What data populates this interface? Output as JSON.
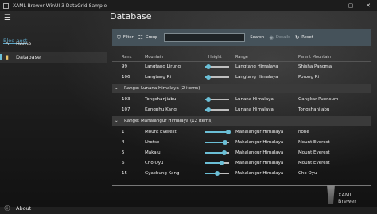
{
  "window": {
    "title": "XAML Brewer WinUI 3 DataGrid Sample",
    "minimize": "—",
    "maximize": "▢",
    "close": "✕"
  },
  "nav": {
    "menu_icon": "hamburger-icon",
    "blog_link": "Blog post",
    "items": [
      {
        "label": "Home",
        "icon": "home-icon"
      },
      {
        "label": "Database",
        "icon": "database-icon",
        "selected": true
      },
      {
        "label": "About",
        "icon": "info-icon"
      }
    ]
  },
  "page": {
    "title": "Database"
  },
  "toolbar": {
    "filter": "Filter",
    "group": "Group",
    "search_value": "",
    "search": "Search",
    "details": "Details",
    "reset": "Reset"
  },
  "grid": {
    "columns": [
      "Rank",
      "Mountain",
      "Height",
      "Range",
      "Parent Mountain"
    ],
    "accent": "#6bbfd6",
    "rows_top": [
      {
        "rank": "99",
        "mountain": "Langtang Lirung",
        "height_level": 0.12,
        "range": "Langtang Himalaya",
        "parent": "Shisha Pangma"
      },
      {
        "rank": "106",
        "mountain": "Langtang Ri",
        "height_level": 0.12,
        "range": "Langtang Himalaya",
        "parent": "Porong Ri"
      }
    ],
    "group1": {
      "label": "Range: Lunana Himalaya (2 items)"
    },
    "rows_g1": [
      {
        "rank": "103",
        "mountain": "Tongshanjiabu",
        "height_level": 0.12,
        "range": "Lunana Himalaya",
        "parent": "Gangkar Puensum"
      },
      {
        "rank": "107",
        "mountain": "Kangphu Kang",
        "height_level": 0.12,
        "range": "Lunana Himalaya",
        "parent": "Tongshanjiabu"
      }
    ],
    "group2": {
      "label": "Range: Mahalangur Himalaya (12 items)"
    },
    "rows_g2": [
      {
        "rank": "1",
        "mountain": "Mount Everest",
        "height_level": 0.95,
        "range": "Mahalangur Himalaya",
        "parent": "none"
      },
      {
        "rank": "4",
        "mountain": "Lhotse",
        "height_level": 0.82,
        "range": "Mahalangur Himalaya",
        "parent": "Mount Everest"
      },
      {
        "rank": "5",
        "mountain": "Makalu",
        "height_level": 0.8,
        "range": "Mahalangur Himalaya",
        "parent": "Mount Everest"
      },
      {
        "rank": "6",
        "mountain": "Cho Oyu",
        "height_level": 0.7,
        "range": "Mahalangur Himalaya",
        "parent": "Mount Everest"
      },
      {
        "rank": "15",
        "mountain": "Gyachung Kang",
        "height_level": 0.5,
        "range": "Mahalangur Himalaya",
        "parent": "Cho Oyu"
      }
    ]
  },
  "brand": {
    "logo_text": "XAML Brewer"
  }
}
